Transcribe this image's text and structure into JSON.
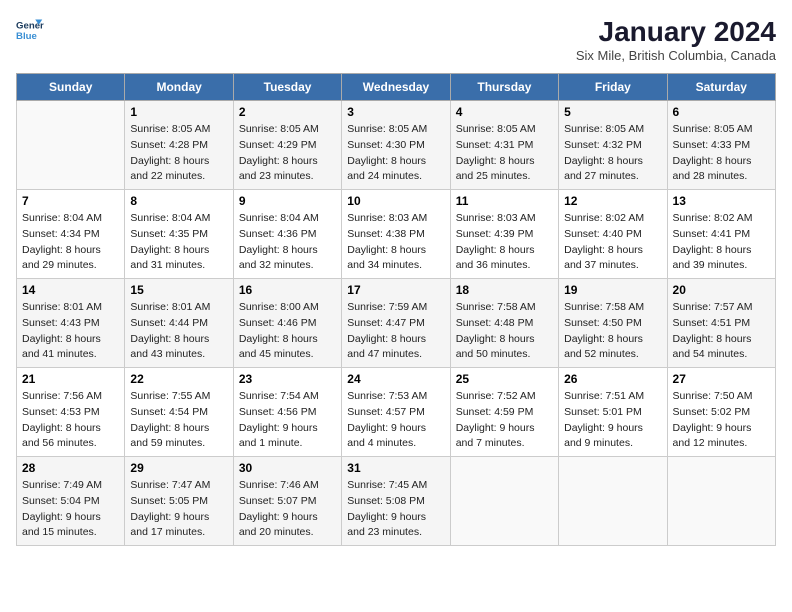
{
  "header": {
    "logo_line1": "General",
    "logo_line2": "Blue",
    "month": "January 2024",
    "location": "Six Mile, British Columbia, Canada"
  },
  "days_of_week": [
    "Sunday",
    "Monday",
    "Tuesday",
    "Wednesday",
    "Thursday",
    "Friday",
    "Saturday"
  ],
  "weeks": [
    [
      {
        "day": "",
        "sunrise": "",
        "sunset": "",
        "daylight": ""
      },
      {
        "day": "1",
        "sunrise": "Sunrise: 8:05 AM",
        "sunset": "Sunset: 4:28 PM",
        "daylight": "Daylight: 8 hours and 22 minutes."
      },
      {
        "day": "2",
        "sunrise": "Sunrise: 8:05 AM",
        "sunset": "Sunset: 4:29 PM",
        "daylight": "Daylight: 8 hours and 23 minutes."
      },
      {
        "day": "3",
        "sunrise": "Sunrise: 8:05 AM",
        "sunset": "Sunset: 4:30 PM",
        "daylight": "Daylight: 8 hours and 24 minutes."
      },
      {
        "day": "4",
        "sunrise": "Sunrise: 8:05 AM",
        "sunset": "Sunset: 4:31 PM",
        "daylight": "Daylight: 8 hours and 25 minutes."
      },
      {
        "day": "5",
        "sunrise": "Sunrise: 8:05 AM",
        "sunset": "Sunset: 4:32 PM",
        "daylight": "Daylight: 8 hours and 27 minutes."
      },
      {
        "day": "6",
        "sunrise": "Sunrise: 8:05 AM",
        "sunset": "Sunset: 4:33 PM",
        "daylight": "Daylight: 8 hours and 28 minutes."
      }
    ],
    [
      {
        "day": "7",
        "sunrise": "Sunrise: 8:04 AM",
        "sunset": "Sunset: 4:34 PM",
        "daylight": "Daylight: 8 hours and 29 minutes."
      },
      {
        "day": "8",
        "sunrise": "Sunrise: 8:04 AM",
        "sunset": "Sunset: 4:35 PM",
        "daylight": "Daylight: 8 hours and 31 minutes."
      },
      {
        "day": "9",
        "sunrise": "Sunrise: 8:04 AM",
        "sunset": "Sunset: 4:36 PM",
        "daylight": "Daylight: 8 hours and 32 minutes."
      },
      {
        "day": "10",
        "sunrise": "Sunrise: 8:03 AM",
        "sunset": "Sunset: 4:38 PM",
        "daylight": "Daylight: 8 hours and 34 minutes."
      },
      {
        "day": "11",
        "sunrise": "Sunrise: 8:03 AM",
        "sunset": "Sunset: 4:39 PM",
        "daylight": "Daylight: 8 hours and 36 minutes."
      },
      {
        "day": "12",
        "sunrise": "Sunrise: 8:02 AM",
        "sunset": "Sunset: 4:40 PM",
        "daylight": "Daylight: 8 hours and 37 minutes."
      },
      {
        "day": "13",
        "sunrise": "Sunrise: 8:02 AM",
        "sunset": "Sunset: 4:41 PM",
        "daylight": "Daylight: 8 hours and 39 minutes."
      }
    ],
    [
      {
        "day": "14",
        "sunrise": "Sunrise: 8:01 AM",
        "sunset": "Sunset: 4:43 PM",
        "daylight": "Daylight: 8 hours and 41 minutes."
      },
      {
        "day": "15",
        "sunrise": "Sunrise: 8:01 AM",
        "sunset": "Sunset: 4:44 PM",
        "daylight": "Daylight: 8 hours and 43 minutes."
      },
      {
        "day": "16",
        "sunrise": "Sunrise: 8:00 AM",
        "sunset": "Sunset: 4:46 PM",
        "daylight": "Daylight: 8 hours and 45 minutes."
      },
      {
        "day": "17",
        "sunrise": "Sunrise: 7:59 AM",
        "sunset": "Sunset: 4:47 PM",
        "daylight": "Daylight: 8 hours and 47 minutes."
      },
      {
        "day": "18",
        "sunrise": "Sunrise: 7:58 AM",
        "sunset": "Sunset: 4:48 PM",
        "daylight": "Daylight: 8 hours and 50 minutes."
      },
      {
        "day": "19",
        "sunrise": "Sunrise: 7:58 AM",
        "sunset": "Sunset: 4:50 PM",
        "daylight": "Daylight: 8 hours and 52 minutes."
      },
      {
        "day": "20",
        "sunrise": "Sunrise: 7:57 AM",
        "sunset": "Sunset: 4:51 PM",
        "daylight": "Daylight: 8 hours and 54 minutes."
      }
    ],
    [
      {
        "day": "21",
        "sunrise": "Sunrise: 7:56 AM",
        "sunset": "Sunset: 4:53 PM",
        "daylight": "Daylight: 8 hours and 56 minutes."
      },
      {
        "day": "22",
        "sunrise": "Sunrise: 7:55 AM",
        "sunset": "Sunset: 4:54 PM",
        "daylight": "Daylight: 8 hours and 59 minutes."
      },
      {
        "day": "23",
        "sunrise": "Sunrise: 7:54 AM",
        "sunset": "Sunset: 4:56 PM",
        "daylight": "Daylight: 9 hours and 1 minute."
      },
      {
        "day": "24",
        "sunrise": "Sunrise: 7:53 AM",
        "sunset": "Sunset: 4:57 PM",
        "daylight": "Daylight: 9 hours and 4 minutes."
      },
      {
        "day": "25",
        "sunrise": "Sunrise: 7:52 AM",
        "sunset": "Sunset: 4:59 PM",
        "daylight": "Daylight: 9 hours and 7 minutes."
      },
      {
        "day": "26",
        "sunrise": "Sunrise: 7:51 AM",
        "sunset": "Sunset: 5:01 PM",
        "daylight": "Daylight: 9 hours and 9 minutes."
      },
      {
        "day": "27",
        "sunrise": "Sunrise: 7:50 AM",
        "sunset": "Sunset: 5:02 PM",
        "daylight": "Daylight: 9 hours and 12 minutes."
      }
    ],
    [
      {
        "day": "28",
        "sunrise": "Sunrise: 7:49 AM",
        "sunset": "Sunset: 5:04 PM",
        "daylight": "Daylight: 9 hours and 15 minutes."
      },
      {
        "day": "29",
        "sunrise": "Sunrise: 7:47 AM",
        "sunset": "Sunset: 5:05 PM",
        "daylight": "Daylight: 9 hours and 17 minutes."
      },
      {
        "day": "30",
        "sunrise": "Sunrise: 7:46 AM",
        "sunset": "Sunset: 5:07 PM",
        "daylight": "Daylight: 9 hours and 20 minutes."
      },
      {
        "day": "31",
        "sunrise": "Sunrise: 7:45 AM",
        "sunset": "Sunset: 5:08 PM",
        "daylight": "Daylight: 9 hours and 23 minutes."
      },
      {
        "day": "",
        "sunrise": "",
        "sunset": "",
        "daylight": ""
      },
      {
        "day": "",
        "sunrise": "",
        "sunset": "",
        "daylight": ""
      },
      {
        "day": "",
        "sunrise": "",
        "sunset": "",
        "daylight": ""
      }
    ]
  ]
}
